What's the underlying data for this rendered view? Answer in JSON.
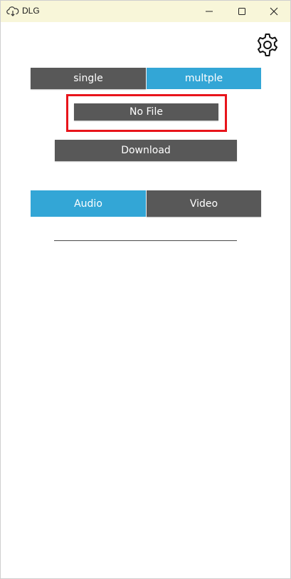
{
  "window": {
    "title": "DLG",
    "icons": {
      "app": "cloud-download-icon",
      "minimize": "minimize-icon",
      "maximize": "maximize-icon",
      "close": "close-icon",
      "settings": "gear-icon"
    }
  },
  "mode": {
    "single_label": "single",
    "multiple_label": "multple",
    "selected": "multple"
  },
  "file": {
    "label": "No File"
  },
  "actions": {
    "download_label": "Download"
  },
  "format": {
    "audio_label": "Audio",
    "video_label": "Video",
    "selected": "Audio"
  },
  "colors": {
    "titlebar": "#f8f6d9",
    "button_dark": "#585858",
    "button_selected": "#33a6d6",
    "highlight": "#e8141b"
  }
}
